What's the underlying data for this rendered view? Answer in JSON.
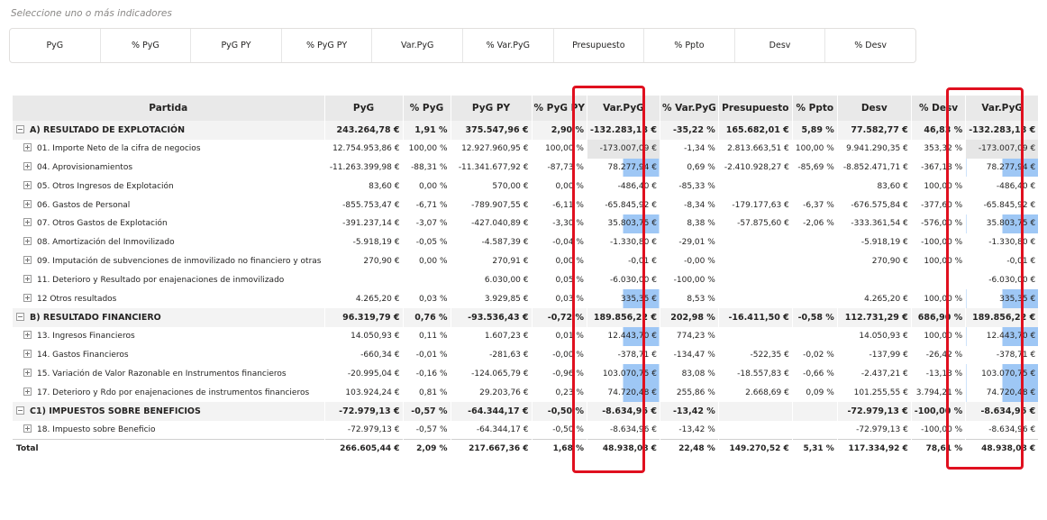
{
  "slicer": {
    "hint": "Seleccione uno o más indicadores",
    "options": [
      "PyG",
      "% PyG",
      "PyG PY",
      "% PyG PY",
      "Var.PyG",
      "% Var.PyG",
      "Presupuesto",
      "% Ppto",
      "Desv",
      "% Desv"
    ]
  },
  "table": {
    "columns": [
      "Partida",
      "PyG",
      "% PyG",
      "PyG PY",
      "% PyG PY",
      "Var.PyG",
      "% Var.PyG",
      "Presupuesto",
      "% Ppto",
      "Desv",
      "% Desv",
      "Var.PyG"
    ],
    "rows": [
      {
        "type": "group",
        "cells": [
          "A) RESULTADO DE EXPLOTACIÓN",
          "243.264,78 €",
          "1,91 %",
          "375.547,96 €",
          "2,90 %",
          "-132.283,18 €",
          "-35,22 %",
          "165.682,01 €",
          "5,89 %",
          "77.582,77 €",
          "46,83 %",
          "-132.283,18 €"
        ]
      },
      {
        "type": "child",
        "cells": [
          "01. Importe Neto de la cifra de negocios",
          "12.754.953,86 €",
          "100,00 %",
          "12.927.960,95 €",
          "100,00 %",
          "-173.007,09 €",
          "-1,34 %",
          "2.813.663,51 €",
          "100,00 %",
          "9.941.290,35 €",
          "353,32 %",
          "-173.007,09 €"
        ]
      },
      {
        "type": "child",
        "cells": [
          "04. Aprovisionamientos",
          "-11.263.399,98 €",
          "-88,31 %",
          "-11.341.677,92 €",
          "-87,73 %",
          "78.277,94 €",
          "0,69 %",
          "-2.410.928,27 €",
          "-85,69 %",
          "-8.852.471,71 €",
          "-367,18 %",
          "78.277,94 €"
        ]
      },
      {
        "type": "child",
        "cells": [
          "05. Otros Ingresos de Explotación",
          "83,60 €",
          "0,00 %",
          "570,00 €",
          "0,00 %",
          "-486,40 €",
          "-85,33 %",
          "",
          "",
          "83,60 €",
          "100,00 %",
          "-486,40 €"
        ]
      },
      {
        "type": "child",
        "cells": [
          "06. Gastos de Personal",
          "-855.753,47 €",
          "-6,71 %",
          "-789.907,55 €",
          "-6,11 %",
          "-65.845,92 €",
          "-8,34 %",
          "-179.177,63 €",
          "-6,37 %",
          "-676.575,84 €",
          "-377,60 %",
          "-65.845,92 €"
        ]
      },
      {
        "type": "child",
        "cells": [
          "07. Otros Gastos de Explotación",
          "-391.237,14 €",
          "-3,07 %",
          "-427.040,89 €",
          "-3,30 %",
          "35.803,75 €",
          "8,38 %",
          "-57.875,60 €",
          "-2,06 %",
          "-333.361,54 €",
          "-576,00 %",
          "35.803,75 €"
        ]
      },
      {
        "type": "child",
        "cells": [
          "08. Amortización del Inmovilizado",
          "-5.918,19 €",
          "-0,05 %",
          "-4.587,39 €",
          "-0,04 %",
          "-1.330,80 €",
          "-29,01 %",
          "",
          "",
          "-5.918,19 €",
          "-100,00 %",
          "-1.330,80 €"
        ]
      },
      {
        "type": "child",
        "cells": [
          "09. Imputación de subvenciones de inmovilizado no financiero y otras",
          "270,90 €",
          "0,00 %",
          "270,91 €",
          "0,00 %",
          "-0,01 €",
          "-0,00 %",
          "",
          "",
          "270,90 €",
          "100,00 %",
          "-0,01 €"
        ]
      },
      {
        "type": "child",
        "cells": [
          "11. Deterioro y Resultado por enajenaciones de inmovilizado",
          "",
          "",
          "6.030,00 €",
          "0,05 %",
          "-6.030,00 €",
          "-100,00 %",
          "",
          "",
          "",
          "",
          "-6.030,00 €"
        ]
      },
      {
        "type": "child",
        "cells": [
          "12 Otros resultados",
          "4.265,20 €",
          "0,03 %",
          "3.929,85 €",
          "0,03 %",
          "335,35 €",
          "8,53 %",
          "",
          "",
          "4.265,20 €",
          "100,00 %",
          "335,35 €"
        ]
      },
      {
        "type": "group",
        "cells": [
          "B) RESULTADO FINANCIERO",
          "96.319,79 €",
          "0,76 %",
          "-93.536,43 €",
          "-0,72 %",
          "189.856,22 €",
          "202,98 %",
          "-16.411,50 €",
          "-0,58 %",
          "112.731,29 €",
          "686,90 %",
          "189.856,22 €"
        ]
      },
      {
        "type": "child",
        "cells": [
          "13. Ingresos Financieros",
          "14.050,93 €",
          "0,11 %",
          "1.607,23 €",
          "0,01 %",
          "12.443,70 €",
          "774,23 %",
          "",
          "",
          "14.050,93 €",
          "100,00 %",
          "12.443,70 €"
        ]
      },
      {
        "type": "child",
        "cells": [
          "14. Gastos Financieros",
          "-660,34 €",
          "-0,01 %",
          "-281,63 €",
          "-0,00 %",
          "-378,71 €",
          "-134,47 %",
          "-522,35 €",
          "-0,02 %",
          "-137,99 €",
          "-26,42 %",
          "-378,71 €"
        ]
      },
      {
        "type": "child",
        "cells": [
          "15. Variación de Valor Razonable en Instrumentos financieros",
          "-20.995,04 €",
          "-0,16 %",
          "-124.065,79 €",
          "-0,96 %",
          "103.070,75 €",
          "83,08 %",
          "-18.557,83 €",
          "-0,66 %",
          "-2.437,21 €",
          "-13,13 %",
          "103.070,75 €"
        ]
      },
      {
        "type": "child",
        "cells": [
          "17. Deterioro y Rdo por enajenaciones de instrumentos financieros",
          "103.924,24 €",
          "0,81 %",
          "29.203,76 €",
          "0,23 %",
          "74.720,48 €",
          "255,86 %",
          "2.668,69 €",
          "0,09 %",
          "101.255,55 €",
          "3.794,21 %",
          "74.720,48 €"
        ]
      },
      {
        "type": "group",
        "cells": [
          "C1) IMPUESTOS SOBRE BENEFICIOS",
          "-72.979,13 €",
          "-0,57 %",
          "-64.344,17 €",
          "-0,50 %",
          "-8.634,96 €",
          "-13,42 %",
          "",
          "",
          "-72.979,13 €",
          "-100,00 %",
          "-8.634,96 €"
        ]
      },
      {
        "type": "child",
        "cells": [
          "18. Impuesto sobre Beneficio",
          "-72.979,13 €",
          "-0,57 %",
          "-64.344,17 €",
          "-0,50 %",
          "-8.634,96 €",
          "-13,42 %",
          "",
          "",
          "-72.979,13 €",
          "-100,00 %",
          "-8.634,96 €"
        ]
      },
      {
        "type": "total",
        "cells": [
          "Total",
          "266.605,44 €",
          "2,09 %",
          "217.667,36 €",
          "1,68 %",
          "48.938,08 €",
          "22,48 %",
          "149.270,52 €",
          "5,31 %",
          "117.334,92 €",
          "78,61 %",
          "48.938,08 €"
        ]
      }
    ]
  },
  "colors": {
    "highlight_border": "#e0101f",
    "header_bg": "#e9e9e9",
    "group_bg": "#f3f3f3",
    "databar": "#9ec7f5"
  }
}
